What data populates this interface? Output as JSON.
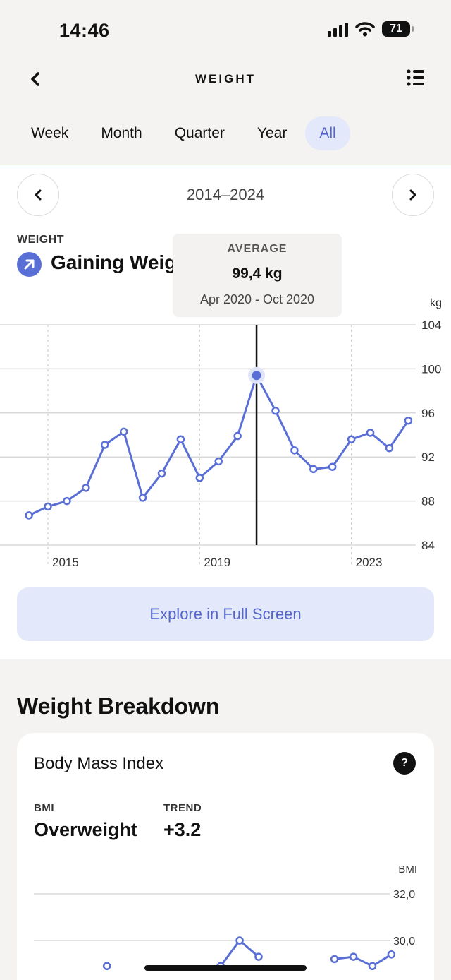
{
  "status_bar": {
    "time": "14:46",
    "battery": "71"
  },
  "header": {
    "title": "WEIGHT"
  },
  "tabs": [
    {
      "label": "Week",
      "active": false
    },
    {
      "label": "Month",
      "active": false
    },
    {
      "label": "Quarter",
      "active": false
    },
    {
      "label": "Year",
      "active": false
    },
    {
      "label": "All",
      "active": true
    }
  ],
  "range": {
    "label": "2014–2024"
  },
  "summary": {
    "label": "WEIGHT",
    "value": "Gaining Weight"
  },
  "tooltip": {
    "title": "AVERAGE",
    "value": "99,4 kg",
    "range": "Apr 2020 - Oct 2020"
  },
  "explore_button": "Explore in Full Screen",
  "colors": {
    "accent": "#5a6fd6",
    "accent_light": "#e3e8fb"
  },
  "chart_data": [
    {
      "type": "line",
      "unit_label": "kg",
      "ylim": [
        84,
        104
      ],
      "y_ticks": [
        "104",
        "100",
        "96",
        "92",
        "88",
        "84"
      ],
      "x_ticks": [
        {
          "label": "2015",
          "year": 2015
        },
        {
          "label": "2019",
          "year": 2019
        },
        {
          "label": "2023",
          "year": 2023
        }
      ],
      "grid": true,
      "selected_point": "2020-07",
      "points": [
        {
          "x": "2014-07",
          "y": 86.7
        },
        {
          "x": "2015-01",
          "y": 87.5
        },
        {
          "x": "2015-07",
          "y": 88.0
        },
        {
          "x": "2016-01",
          "y": 89.2
        },
        {
          "x": "2016-07",
          "y": 93.1
        },
        {
          "x": "2017-01",
          "y": 94.3
        },
        {
          "x": "2017-07",
          "y": 88.3
        },
        {
          "x": "2018-01",
          "y": 90.5
        },
        {
          "x": "2018-07",
          "y": 93.6
        },
        {
          "x": "2019-01",
          "y": 90.1
        },
        {
          "x": "2019-07",
          "y": 91.6
        },
        {
          "x": "2020-01",
          "y": 93.9
        },
        {
          "x": "2020-07",
          "y": 99.4
        },
        {
          "x": "2021-01",
          "y": 96.2
        },
        {
          "x": "2021-07",
          "y": 92.6
        },
        {
          "x": "2022-01",
          "y": 90.9
        },
        {
          "x": "2022-07",
          "y": 91.1
        },
        {
          "x": "2023-01",
          "y": 93.6
        },
        {
          "x": "2023-07",
          "y": 94.2
        },
        {
          "x": "2024-01",
          "y": 92.8
        },
        {
          "x": "2024-07",
          "y": 95.3
        }
      ]
    },
    {
      "type": "line",
      "unit_label": "BMI",
      "ylim": [
        28,
        32
      ],
      "y_ticks": [
        "32,0",
        "30,0"
      ],
      "grid": true,
      "points": [
        {
          "x": "2017-01",
          "y": 28.9
        },
        {
          "x": "2020-01",
          "y": 28.9
        },
        {
          "x": "2020-07",
          "y": 30.0
        },
        {
          "x": "2021-01",
          "y": 29.3
        },
        {
          "x": "2023-01",
          "y": 29.2
        },
        {
          "x": "2023-07",
          "y": 29.3
        },
        {
          "x": "2024-01",
          "y": 28.9
        },
        {
          "x": "2024-07",
          "y": 29.4
        }
      ]
    }
  ],
  "breakdown": {
    "title": "Weight Breakdown",
    "card_title": "Body Mass Index",
    "help": "?",
    "bmi_label": "BMI",
    "bmi_value": "Overweight",
    "trend_label": "TREND",
    "trend_value": "+3.2"
  }
}
